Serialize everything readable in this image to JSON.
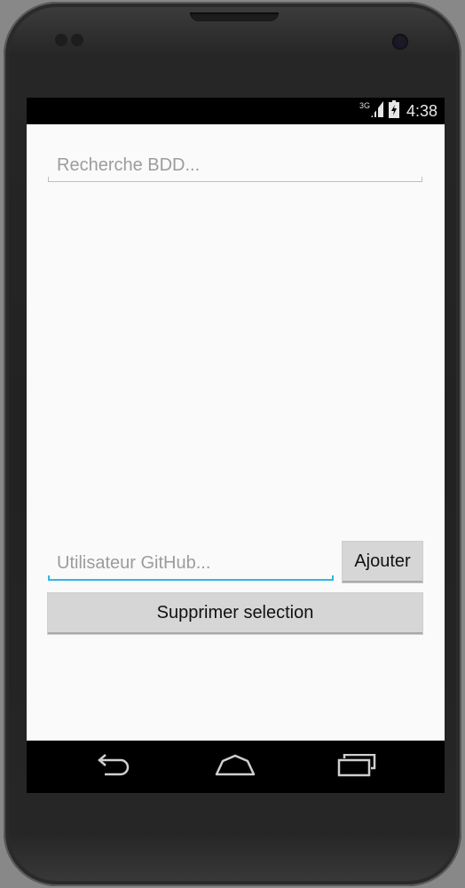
{
  "status_bar": {
    "network_type": "3G",
    "time": "4:38",
    "signal_icon": "signal-strength-icon",
    "battery_icon": "battery-charging-icon"
  },
  "search": {
    "placeholder": "Recherche BDD..."
  },
  "user_input": {
    "placeholder": "Utilisateur GitHub..."
  },
  "buttons": {
    "add_label": "Ajouter",
    "delete_selection_label": "Supprimer selection"
  },
  "nav_bar": {
    "back_icon": "back-arrow-icon",
    "home_icon": "home-icon",
    "recents_icon": "recent-apps-icon"
  },
  "colors": {
    "accent": "#33b5e5",
    "screen_background": "#fafafa",
    "button_background": "#d6d6d6",
    "bars": "#000000"
  }
}
